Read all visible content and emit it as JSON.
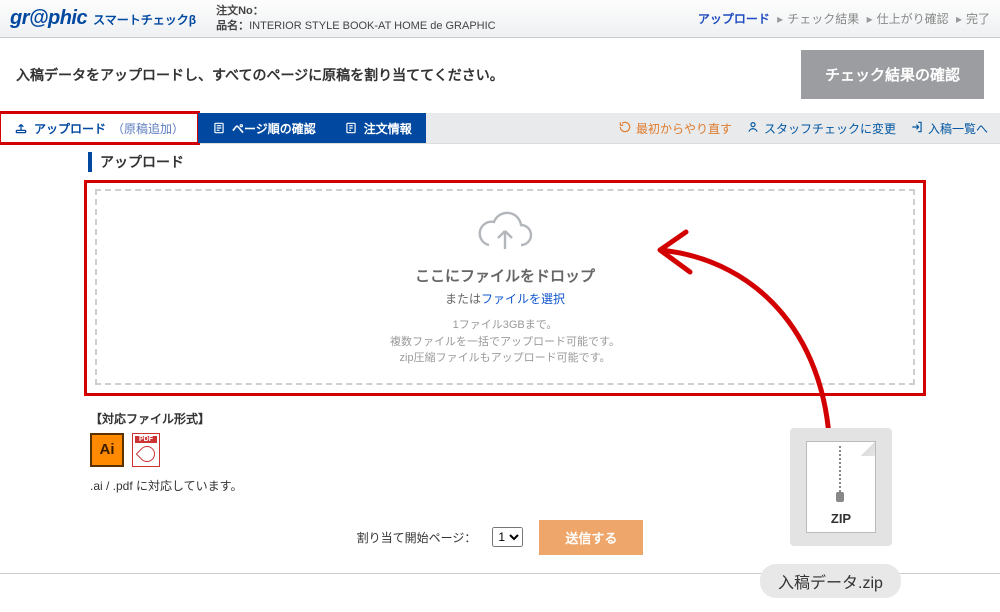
{
  "header": {
    "logo_main": "gr@phic",
    "logo_sub": "スマートチェックβ",
    "order_no_label": "注文No：",
    "order_no_value": "",
    "product_label": "品名：",
    "product_value": "INTERIOR STYLE BOOK-AT HOME de GRAPHIC"
  },
  "breadcrumb": {
    "current": "アップロード",
    "steps": [
      "チェック結果",
      "仕上がり確認",
      "完了"
    ]
  },
  "instruction": "入稿データをアップロードし、すべてのページに原稿を割り当ててください。",
  "check_button": "チェック結果の確認",
  "tabs": {
    "upload": "アップロード",
    "upload_sub": "（原稿追加）",
    "page_order": "ページ順の確認",
    "order_info": "注文情報"
  },
  "toolbar": {
    "restart": "最初からやり直す",
    "staff_check": "スタッフチェックに変更",
    "list": "入稿一覧へ"
  },
  "section_title": "アップロード",
  "drop": {
    "heading": "ここにファイルをドロップ",
    "or_prefix": "または",
    "or_link": "ファイルを選択",
    "line1": "1ファイル3GBまで。",
    "line2": "複数ファイルを一括でアップロード可能です。",
    "line3": "zip圧縮ファイルもアップロード可能です。"
  },
  "formats": {
    "heading": "【対応ファイル形式】",
    "ai_label": "Ai",
    "desc": ".ai / .pdf に対応しています。"
  },
  "controls": {
    "page_start_label": "割り当て開始ページ：",
    "page_start_value": "1",
    "submit": "送信する"
  },
  "zip": {
    "badge": "ZIP",
    "caption": "入稿データ.zip"
  }
}
